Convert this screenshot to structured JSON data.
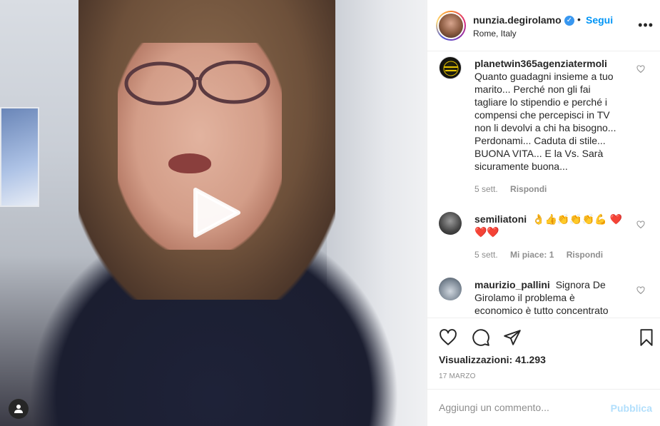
{
  "post": {
    "username": "nunzia.degirolamo",
    "verified_mark": "✓",
    "separator": "•",
    "follow_label": "Segui",
    "location": "Rome, Italy",
    "more_label": "•••"
  },
  "comments": [
    {
      "username": "planetwin365agenziatermoli",
      "text": "Quanto guadagni insieme a tuo marito... Perché non gli fai tagliare lo stipendio e perché i compensi che percepisci in TV non li devolvi a chi ha bisogno... Perdonami... Caduta di stile... BUONA VITA... E la Vs. Sarà sicuramente buona...",
      "time": "5 sett.",
      "likes": "",
      "reply_label": "Rispondi"
    },
    {
      "username": "semiliatoni",
      "text": "👌👍👏👏👏💪 ❤️❤️❤️",
      "time": "5 sett.",
      "likes": "Mi piace: 1",
      "reply_label": "Rispondi"
    },
    {
      "username": "maurizio_pallini",
      "text": "Signora De Girolamo il problema è economico è tutto concentrato",
      "time": "",
      "likes": "",
      "reply_label": ""
    }
  ],
  "stats": {
    "views": "Visualizzazioni: 41.293",
    "date": "17 MARZO"
  },
  "composer": {
    "placeholder": "Aggiungi un commento...",
    "publish_label": "Pubblica"
  },
  "icons": {
    "like": "heart-icon",
    "comment": "comment-icon",
    "share": "paper-plane-icon",
    "save": "bookmark-icon",
    "play": "play-icon",
    "user_tag": "user-tag-icon"
  },
  "colors": {
    "accent": "#0095f6",
    "verified": "#3897f0",
    "muted": "#8e8e8e",
    "publish_disabled": "#b2dffc"
  }
}
